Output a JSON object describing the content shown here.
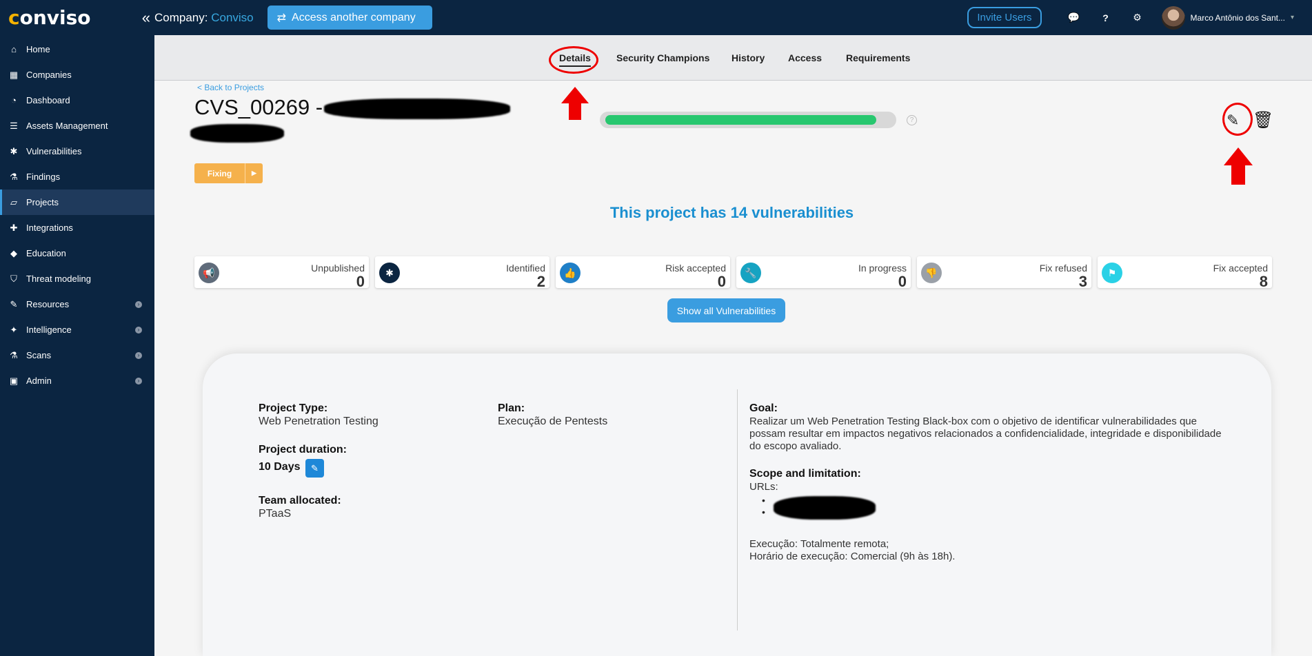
{
  "header": {
    "logo": "conviso",
    "company_label": "Company:",
    "company_name": "Conviso",
    "access_button": "Access another company",
    "invite_button": "Invite Users",
    "user_name": "Marco Antônio dos Sant..."
  },
  "sidebar": {
    "items": [
      {
        "label": "Home",
        "icon": "home-icon"
      },
      {
        "label": "Companies",
        "icon": "building-icon"
      },
      {
        "label": "Dashboard",
        "icon": "dashboard-icon"
      },
      {
        "label": "Assets Management",
        "icon": "server-icon"
      },
      {
        "label": "Vulnerabilities",
        "icon": "bug-icon"
      },
      {
        "label": "Findings",
        "icon": "flask-icon"
      },
      {
        "label": "Projects",
        "icon": "folder-open-icon"
      },
      {
        "label": "Integrations",
        "icon": "puzzle-icon"
      },
      {
        "label": "Education",
        "icon": "graduation-cap-icon"
      },
      {
        "label": "Threat modeling",
        "icon": "shield-icon"
      },
      {
        "label": "Resources",
        "icon": "wrench-icon"
      },
      {
        "label": "Intelligence",
        "icon": "lightbulb-icon"
      },
      {
        "label": "Scans",
        "icon": "flask-icon"
      },
      {
        "label": "Admin",
        "icon": "briefcase-icon"
      }
    ]
  },
  "tabs": [
    "Details",
    "Security Champions",
    "History",
    "Access",
    "Requirements"
  ],
  "project": {
    "back_link": "< Back to Projects",
    "title": "CVS_00269 -",
    "progress": 0.95,
    "status": "Fixing"
  },
  "vuln_summary": {
    "heading": "This project has 14 vulnerabilities",
    "cards": [
      {
        "label": "Unpublished",
        "value": "0",
        "icon": "megaphone-icon",
        "color": "#5f6b7a"
      },
      {
        "label": "Identified",
        "value": "2",
        "icon": "bug-icon",
        "color": "#0b2541"
      },
      {
        "label": "Risk accepted",
        "value": "0",
        "icon": "thumbs-up-icon",
        "color": "#1f7fc7"
      },
      {
        "label": "In progress",
        "value": "0",
        "icon": "wrench-icon",
        "color": "#16a3c2"
      },
      {
        "label": "Fix refused",
        "value": "3",
        "icon": "thumbs-down-icon",
        "color": "#9aa0a8"
      },
      {
        "label": "Fix accepted",
        "value": "8",
        "icon": "flag-checkered-icon",
        "color": "#2ad1e6"
      }
    ],
    "show_all_button": "Show all Vulnerabilities"
  },
  "details": {
    "project_type_label": "Project Type:",
    "project_type": "Web Penetration Testing",
    "plan_label": "Plan:",
    "plan": "Execução de Pentests",
    "duration_label": "Project duration:",
    "duration": "10 Days",
    "team_label": "Team allocated:",
    "team": "PTaaS",
    "goal_label": "Goal:",
    "goal": "Realizar um Web Penetration Testing Black-box com o objetivo de identificar vulnerabilidades que possam resultar em impactos negativos relacionados a confidencialidade, integridade e disponibilidade do escopo avaliado.",
    "scope_label": "Scope and limitation:",
    "urls_label": "URLs:",
    "execution": "Execução: Totalmente remota;",
    "schedule": "Horário de execução: Comercial (9h às 18h)."
  }
}
